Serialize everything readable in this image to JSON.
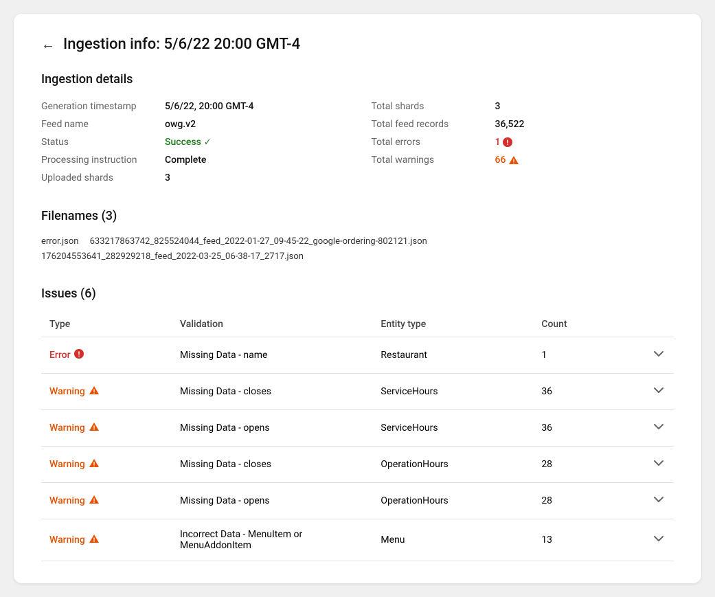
{
  "page": {
    "title": "Ingestion info: 5/6/22 20:00 GMT-4"
  },
  "ingestion_details": {
    "section_title": "Ingestion details",
    "left": [
      {
        "label": "Generation timestamp",
        "value": "5/6/22, 20:00 GMT-4",
        "bold": true
      },
      {
        "label": "Feed name",
        "value": "owg.v2",
        "bold": true
      },
      {
        "label": "Status",
        "value": "Success",
        "type": "success"
      },
      {
        "label": "Processing instruction",
        "value": "Complete",
        "bold": true
      },
      {
        "label": "Uploaded shards",
        "value": "3",
        "bold": true
      }
    ],
    "right": [
      {
        "label": "Total shards",
        "value": "3",
        "bold": true
      },
      {
        "label": "Total feed records",
        "value": "36,522",
        "bold": true
      },
      {
        "label": "Total errors",
        "value": "1",
        "type": "error"
      },
      {
        "label": "Total warnings",
        "value": "66",
        "type": "warning"
      }
    ]
  },
  "filenames": {
    "section_title": "Filenames (3)",
    "files": [
      "error.json",
      "633217863742_825524044_feed_2022-01-27_09-45-22_google-ordering-802121.json",
      "176204553641_282929218_feed_2022-03-25_06-38-17_2717.json"
    ]
  },
  "issues": {
    "section_title": "Issues (6)",
    "columns": [
      "Type",
      "Validation",
      "Entity type",
      "Count"
    ],
    "rows": [
      {
        "type": "Error",
        "type_class": "error",
        "validation": "Missing Data - name",
        "entity": "Restaurant",
        "count": "1"
      },
      {
        "type": "Warning",
        "type_class": "warning",
        "validation": "Missing Data - closes",
        "entity": "ServiceHours",
        "count": "36"
      },
      {
        "type": "Warning",
        "type_class": "warning",
        "validation": "Missing Data - opens",
        "entity": "ServiceHours",
        "count": "36"
      },
      {
        "type": "Warning",
        "type_class": "warning",
        "validation": "Missing Data - closes",
        "entity": "OperationHours",
        "count": "28"
      },
      {
        "type": "Warning",
        "type_class": "warning",
        "validation": "Missing Data - opens",
        "entity": "OperationHours",
        "count": "28"
      },
      {
        "type": "Warning",
        "type_class": "warning",
        "validation": "Incorrect Data - MenuItem or MenuAddonItem",
        "entity": "Menu",
        "count": "13"
      }
    ]
  },
  "icons": {
    "back_arrow": "←",
    "check": "✓",
    "chevron_down": "⌄"
  }
}
